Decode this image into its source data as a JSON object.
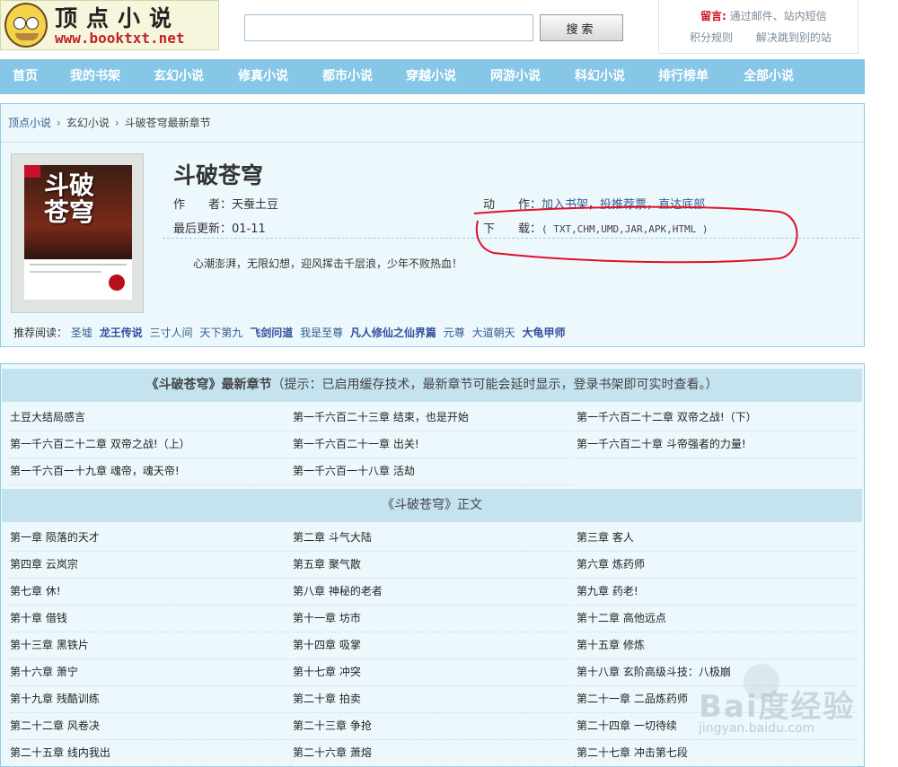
{
  "site": {
    "logo_title": "顶点小说",
    "logo_url": "www.booktxt.net"
  },
  "search": {
    "button": "搜索",
    "placeholder": ""
  },
  "top_links": {
    "label": "留言:",
    "msg": "通过邮件、站内短信",
    "link1": "积分规则",
    "link2": "解决跳到别的站"
  },
  "nav": [
    "首页",
    "我的书架",
    "玄幻小说",
    "修真小说",
    "都市小说",
    "穿越小说",
    "网游小说",
    "科幻小说",
    "排行榜单",
    "全部小说"
  ],
  "breadcrumb": {
    "home": "顶点小说",
    "category": "玄幻小说",
    "current": "斗破苍穹最新章节",
    "sep": "›"
  },
  "book": {
    "cover_title": "斗破苍穹",
    "title": "斗破苍穹",
    "author_label": "作　　者：",
    "author": "天蚕土豆",
    "update_label": "最后更新：",
    "update": "01-11",
    "action_label": "动　　作：",
    "actions": [
      "加入书架",
      "投推荐票",
      "直达底部"
    ],
    "action_sep": "，",
    "download_label": "下　　载：",
    "download": "( TXT,CHM,UMD,JAR,APK,HTML )",
    "intro": "心潮澎湃，无限幻想，迎风挥击千层浪，少年不败热血！"
  },
  "recommend": {
    "label": "推荐阅读：",
    "items": [
      {
        "t": "圣墟",
        "b": false
      },
      {
        "t": "龙王传说",
        "b": true
      },
      {
        "t": "三寸人间",
        "b": false
      },
      {
        "t": "天下第九",
        "b": false
      },
      {
        "t": "飞剑问道",
        "b": true
      },
      {
        "t": "我是至尊",
        "b": false
      },
      {
        "t": "凡人修仙之仙界篇",
        "b": true
      },
      {
        "t": "元尊",
        "b": false
      },
      {
        "t": "大道朝天",
        "b": false
      },
      {
        "t": "大龟甲师",
        "b": true
      }
    ]
  },
  "latest": {
    "heading_em": "《斗破苍穹》最新章节",
    "heading_note": "（提示：已启用缓存技术，最新章节可能会延时显示，登录书架即可实时查看。）",
    "chapters": [
      "土豆大结局感言",
      "第一千六百二十三章 结束，也是开始",
      "第一千六百二十二章 双帝之战!（下）",
      "第一千六百二十二章 双帝之战!（上）",
      "第一千六百二十一章 出关!",
      "第一千六百二十章 斗帝强者的力量!",
      "第一千六百一十九章 魂帝，魂天帝!",
      "第一千六百一十八章 活劫"
    ]
  },
  "main": {
    "heading": "《斗破苍穹》正文",
    "chapters": [
      "第一章 陨落的天才",
      "第二章 斗气大陆",
      "第三章 客人",
      "第四章 云岚宗",
      "第五章 聚气散",
      "第六章 炼药师",
      "第七章 休!",
      "第八章 神秘的老者",
      "第九章 药老!",
      "第十章 借钱",
      "第十一章 坊市",
      "第十二章 高他远点",
      "第十三章 黑铁片",
      "第十四章 吸掌",
      "第十五章 修炼",
      "第十六章 萧宁",
      "第十七章 冲突",
      "第十八章 玄阶高级斗技：八极崩",
      "第十九章 残酷训练",
      "第二十章 拍卖",
      "第二十一章 二品炼药师",
      "第二十二章 风卷决",
      "第二十三章 争抢",
      "第二十四章 一切待续",
      "第二十五章 线内我出",
      "第二十六章 萧熔",
      "第二十七章 冲击第七段"
    ]
  },
  "watermark": {
    "brand": "Bai度经验",
    "url": "jingyan.baidu.com"
  },
  "colors": {
    "nav_bg": "#86c6e6",
    "panel_bg": "#edf8fd",
    "link": "#335d8c",
    "annotation": "#e0102a"
  }
}
